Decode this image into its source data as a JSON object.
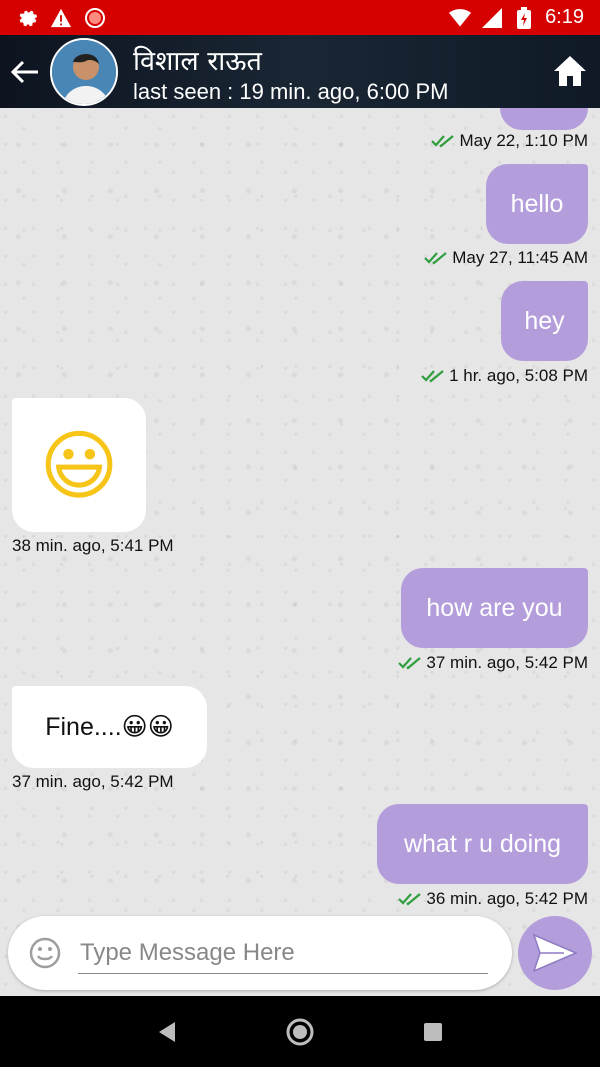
{
  "status_bar": {
    "time": "6:19",
    "icons": [
      "settings-icon",
      "warning-icon",
      "record-icon",
      "wifi-icon",
      "signal-icon",
      "battery-icon"
    ],
    "bg_color": "#d50000"
  },
  "header": {
    "contact_name": "विशाल राऊत",
    "last_seen": "last seen : 19 min. ago, 6:00 PM"
  },
  "messages": [
    {
      "direction": "out",
      "text": "",
      "time": "May 22, 1:10 PM"
    },
    {
      "direction": "out",
      "text": "hello",
      "time": "May 27, 11:45 AM"
    },
    {
      "direction": "out",
      "text": "hey",
      "time": "1 hr. ago, 5:08 PM"
    },
    {
      "direction": "in",
      "text": "😃",
      "time": "38 min. ago, 5:41 PM"
    },
    {
      "direction": "out",
      "text": "how are you",
      "time": "37 min. ago, 5:42 PM"
    },
    {
      "direction": "in",
      "text": "Fine....😀😀",
      "time": "37 min. ago, 5:42 PM"
    },
    {
      "direction": "out",
      "text": "what r u doing",
      "time": "36 min. ago, 5:42 PM"
    }
  ],
  "input": {
    "placeholder": "Type Message Here",
    "value": ""
  },
  "colors": {
    "accent": "#b39ddb",
    "tick": "#2e9e3f"
  }
}
